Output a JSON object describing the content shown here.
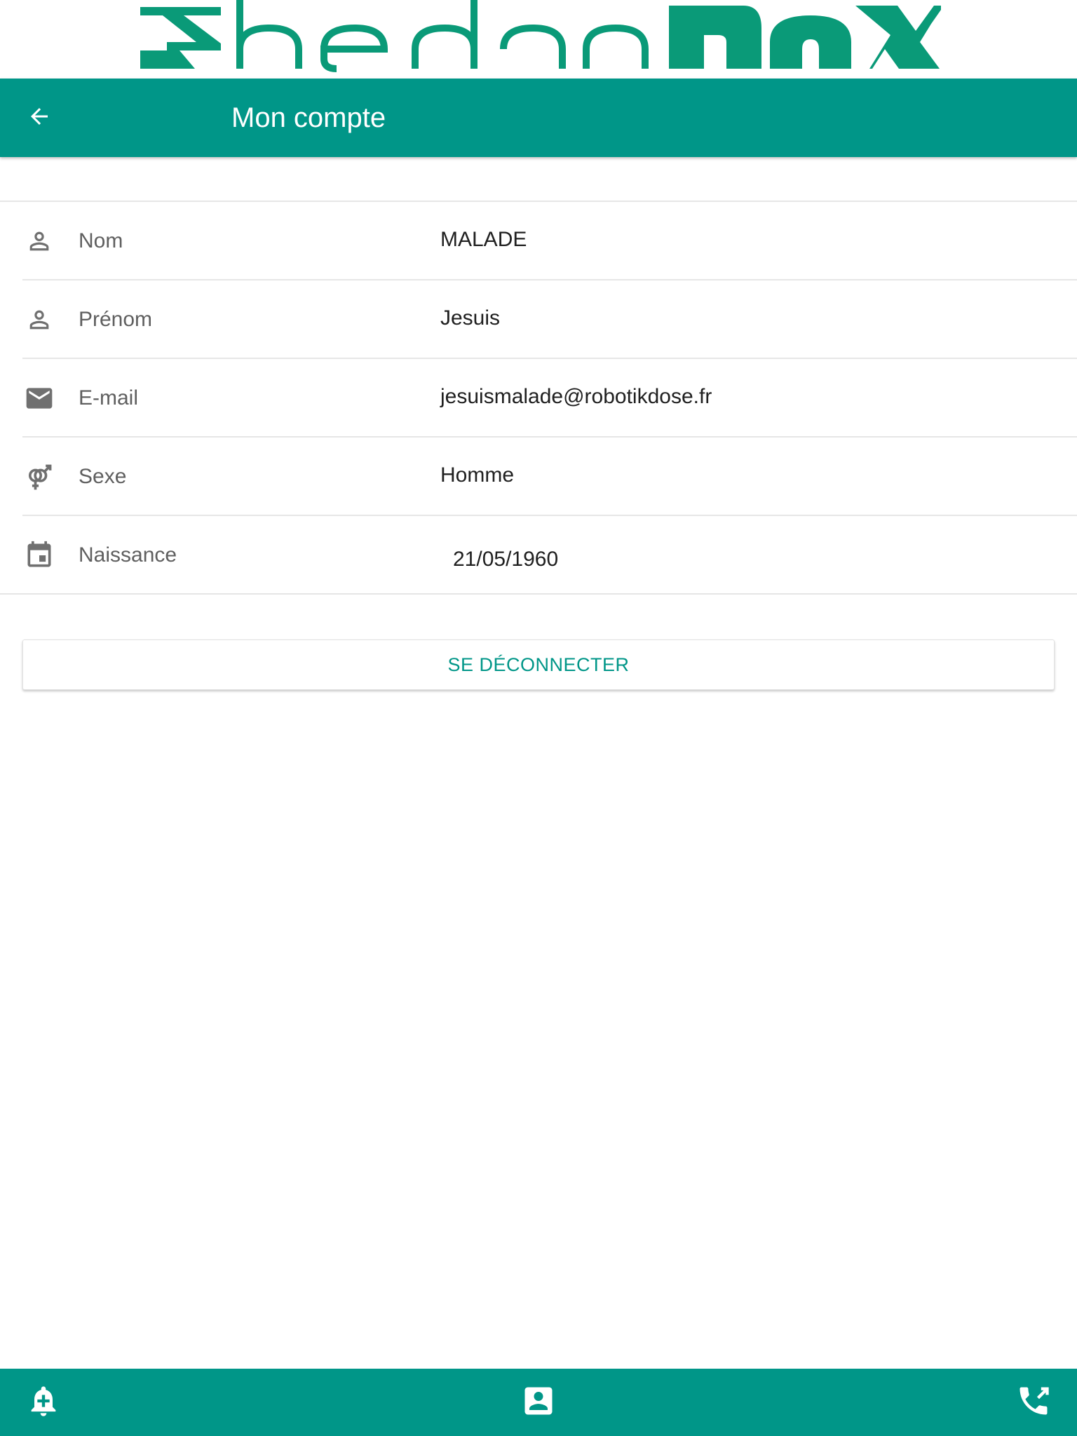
{
  "logo": {
    "text": "hebdoBOX",
    "color": "#0a9a78"
  },
  "toolbar": {
    "title": "Mon compte",
    "back_icon": "arrow-back-icon",
    "color": "#009688"
  },
  "profile_rows": [
    {
      "icon": "person-icon",
      "label": "Nom",
      "value": "MALADE"
    },
    {
      "icon": "person-icon",
      "label": "Prénom",
      "value": "Jesuis"
    },
    {
      "icon": "email-icon",
      "label": "E-mail",
      "value": "jesuismalade@robotikdose.fr"
    },
    {
      "icon": "gender-icon",
      "label": "Sexe",
      "value": "Homme"
    },
    {
      "icon": "calendar-icon",
      "label": "Naissance",
      "value": "21/05/1960"
    }
  ],
  "logout": {
    "label": "SE DÉCONNECTER"
  },
  "bottom_bar": {
    "items": [
      {
        "icon": "bell-plus-icon"
      },
      {
        "icon": "account-box-icon"
      },
      {
        "icon": "phone-forward-icon"
      }
    ]
  }
}
